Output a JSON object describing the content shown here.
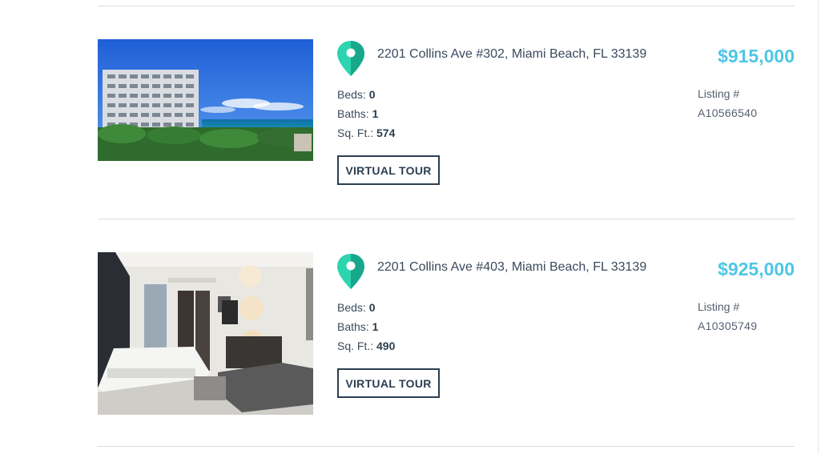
{
  "listings": [
    {
      "address": "2201 Collins Ave #302, Miami Beach, FL 33139",
      "beds_label": "Beds:",
      "beds": "0",
      "baths_label": "Baths:",
      "baths": "1",
      "sqft_label": "Sq. Ft.:",
      "sqft": "574",
      "tour_label": "VIRTUAL TOUR",
      "price": "$915,000",
      "listing_label": "Listing #",
      "listing_id": "A10566540",
      "photo_icon": "building-exterior-photo"
    },
    {
      "address": "2201 Collins Ave #403, Miami Beach, FL 33139",
      "beds_label": "Beds:",
      "beds": "0",
      "baths_label": "Baths:",
      "baths": "1",
      "sqft_label": "Sq. Ft.:",
      "sqft": "490",
      "tour_label": "VIRTUAL TOUR",
      "price": "$925,000",
      "listing_label": "Listing #",
      "listing_id": "A10305749",
      "photo_icon": "apartment-interior-photo"
    }
  ],
  "colors": {
    "price": "#4dc6e6",
    "pin_light": "#2dd4b0",
    "pin_dark": "#17a88b",
    "text": "#2c3e50",
    "divider": "#dcdcdc"
  },
  "icons": {
    "location": "map-pin-icon"
  }
}
